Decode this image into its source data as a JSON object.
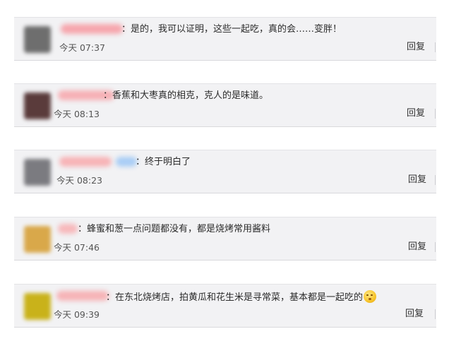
{
  "comments": [
    {
      "text": "：是的，我可以证明，这些一起吃，真的会……变胖！",
      "time": "今天 07:37",
      "reply": "回复",
      "avatar_color": "#6e6e6e",
      "name_color": "#f6a6ad"
    },
    {
      "text": "：香蕉和大枣真的相克，克人的是味道。",
      "time": "今天 08:13",
      "reply": "回复",
      "avatar_color": "#5a3b3b",
      "name_color": "#f6b0b5"
    },
    {
      "text": "：终于明白了",
      "time": "今天 08:23",
      "reply": "回复",
      "avatar_color": "#7b7b80",
      "name_color": "#f7b3b6",
      "badge_color": "#a9cdf5"
    },
    {
      "text": "：蜂蜜和葱一点问题都没有，都是烧烤常用酱料",
      "time": "今天 07:46",
      "reply": "回复",
      "avatar_color": "#d9a84a",
      "name_color": "#f7b8bb"
    },
    {
      "text": "：在东北烧烤店，拍黄瓜和花生米是寻常菜，基本都是一起吃的",
      "time": "今天 09:39",
      "reply": "回复",
      "avatar_color": "#c9b21a",
      "name_color": "#f6b3b6",
      "emoji_icon": "emoji-icon"
    }
  ]
}
